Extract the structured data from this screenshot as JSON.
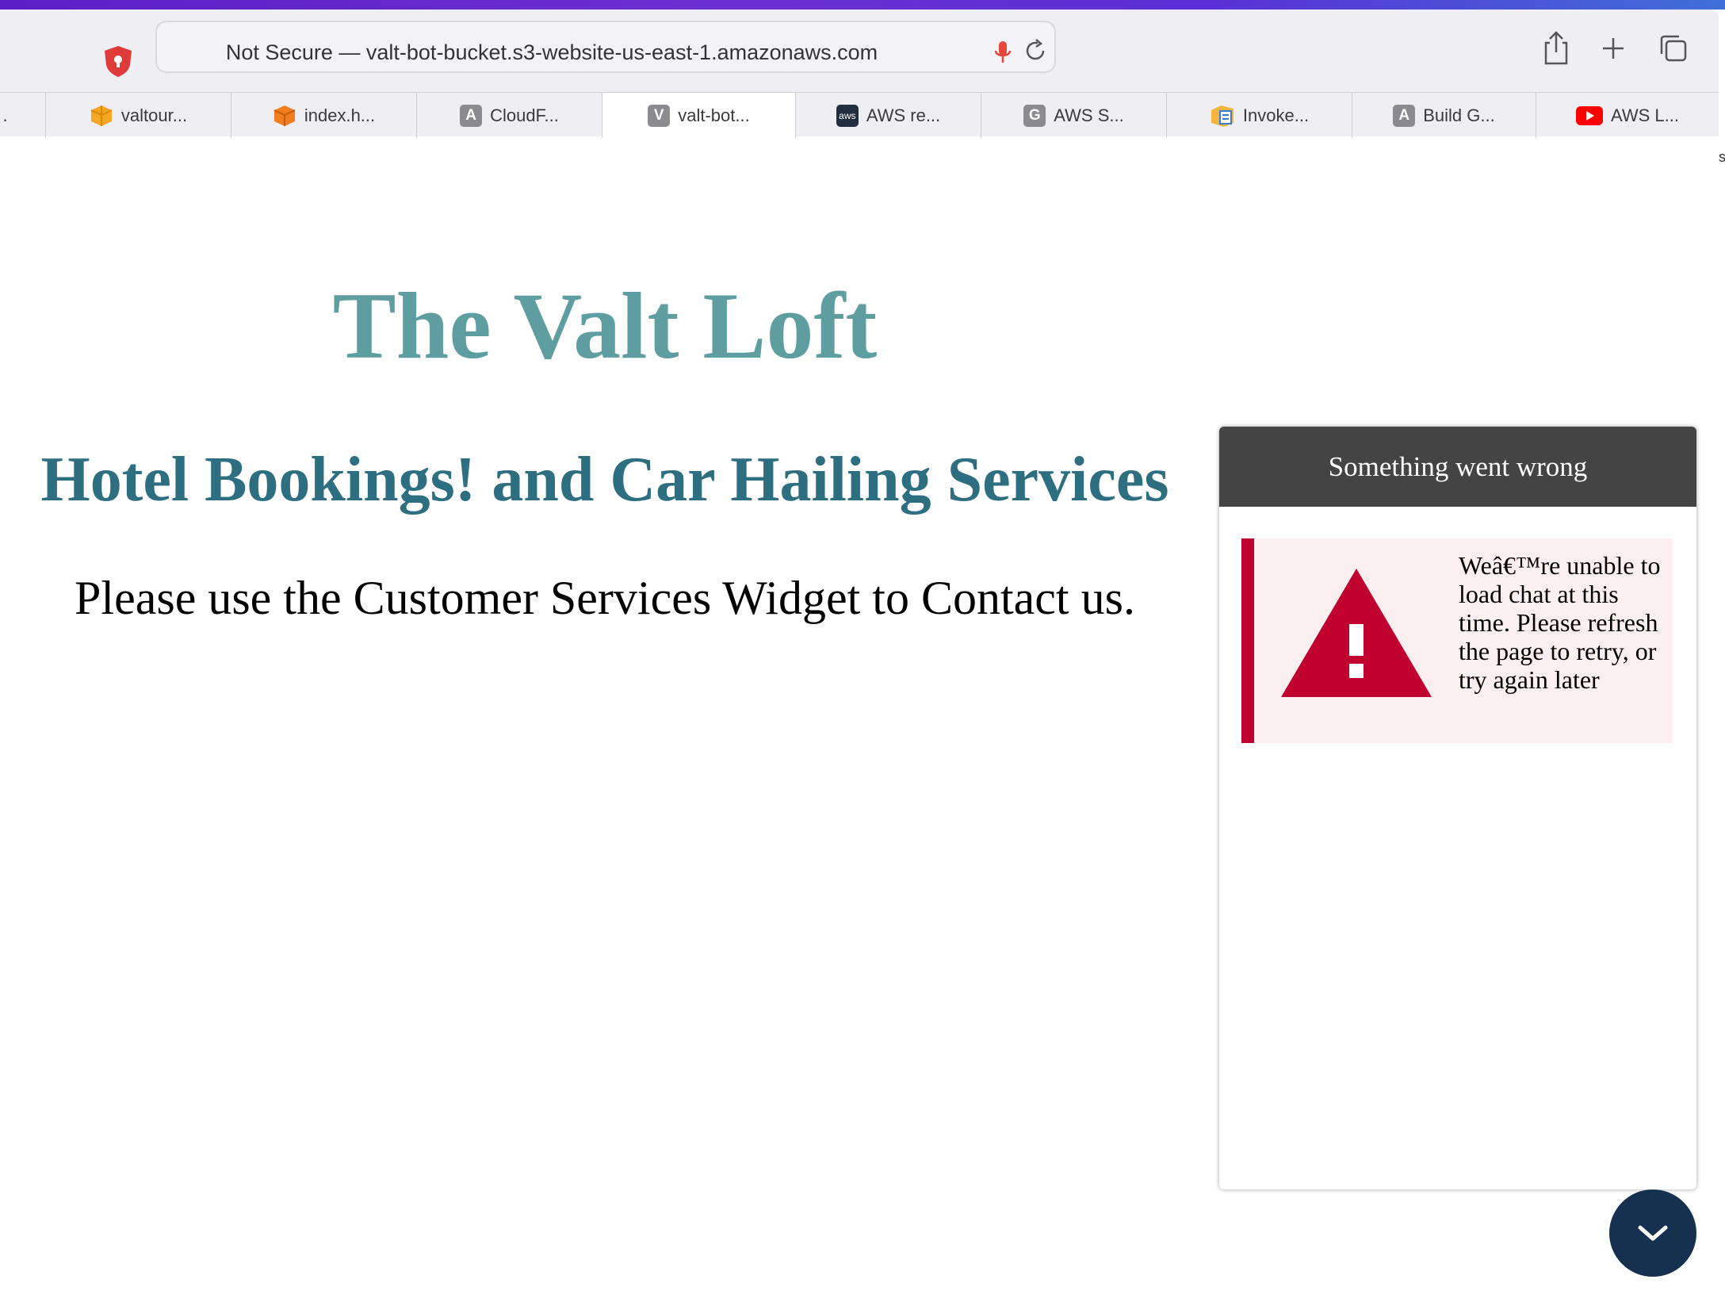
{
  "browser": {
    "url_text": "Not Secure — valt-bot-bucket.s3-website-us-east-1.amazonaws.com",
    "tabs": [
      {
        "label": "valtour...",
        "icon": "aws-box-icon"
      },
      {
        "label": "index.h...",
        "icon": "orange-cube-icon"
      },
      {
        "label": "CloudF...",
        "icon": "letter-a-icon",
        "letter": "A"
      },
      {
        "label": "valt-bot...",
        "icon": "letter-v-icon",
        "letter": "V",
        "active": true
      },
      {
        "label": "AWS re...",
        "icon": "aws-logo-icon",
        "letter": "aws"
      },
      {
        "label": "AWS S...",
        "icon": "letter-g-icon",
        "letter": "G"
      },
      {
        "label": "Invoke...",
        "icon": "document-box-icon"
      },
      {
        "label": "Build G...",
        "icon": "letter-a-icon",
        "letter": "A"
      },
      {
        "label": "AWS L...",
        "icon": "youtube-icon"
      }
    ],
    "edge_mark": "s"
  },
  "page": {
    "title": "The Valt Loft",
    "subtitle": "Hotel Bookings! and Car Hailing Services",
    "note": "Please use the Customer Services Widget to Contact us."
  },
  "widget": {
    "header": "Something went wrong",
    "error_message": "Weâ€™re unable to load chat at this time. Please refresh the page to retry, or try again later"
  },
  "colors": {
    "title": "#5f9ea0",
    "subtitle": "#2d6e80",
    "widget_header": "#444444",
    "error_accent": "#c0002e",
    "error_bg": "#fbf0ef",
    "collapse_button": "#16304f"
  }
}
